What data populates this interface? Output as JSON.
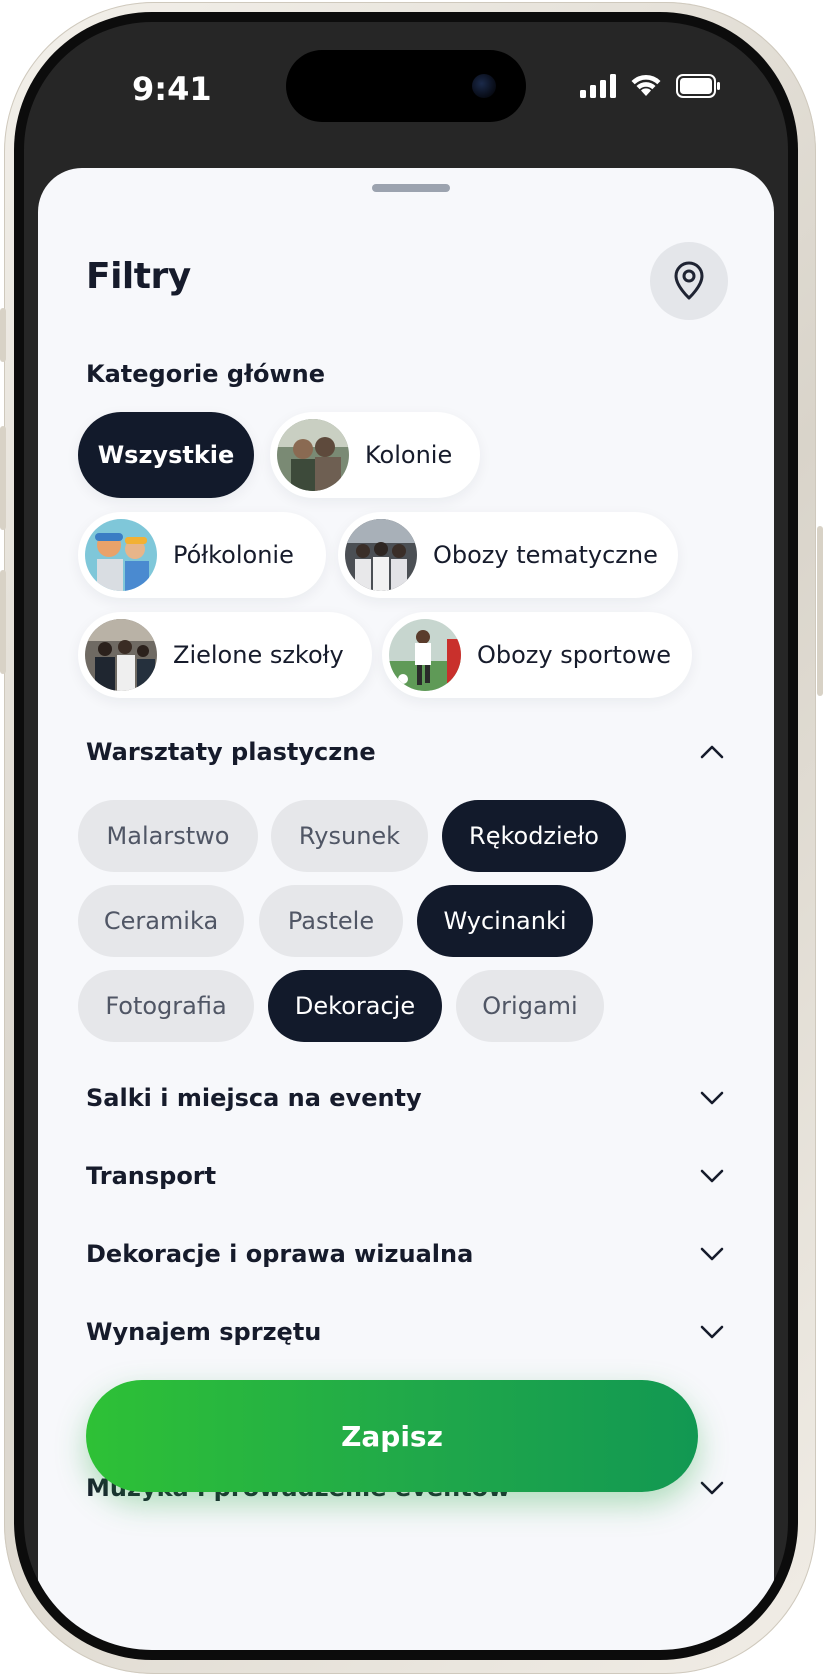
{
  "status_bar": {
    "time": "9:41"
  },
  "sheet": {
    "title": "Filtry",
    "main_categories_label": "Kategorie główne",
    "categories": [
      {
        "label": "Wszystkie",
        "selected": true
      },
      {
        "label": "Kolonie",
        "selected": false
      },
      {
        "label": "Półkolonie",
        "selected": false
      },
      {
        "label": "Obozy tematyczne",
        "selected": false
      },
      {
        "label": "Zielone szkoły",
        "selected": false
      },
      {
        "label": "Obozy sportowe",
        "selected": false
      }
    ],
    "expanded_section": {
      "label": "Warsztaty plastyczne",
      "expanded": true,
      "options": [
        {
          "label": "Malarstwo",
          "selected": false
        },
        {
          "label": "Rysunek",
          "selected": false
        },
        {
          "label": "Rękodzieło",
          "selected": true
        },
        {
          "label": "Ceramika",
          "selected": false
        },
        {
          "label": "Pastele",
          "selected": false
        },
        {
          "label": "Wycinanki",
          "selected": true
        },
        {
          "label": "Fotografia",
          "selected": false
        },
        {
          "label": "Dekoracje",
          "selected": true
        },
        {
          "label": "Origami",
          "selected": false
        }
      ]
    },
    "collapsed_sections": [
      "Salki i miejsca na eventy",
      "Transport",
      "Dekoracje i oprawa wizualna",
      "Wynajem sprzętu",
      "Muzyka i prowadzenie eventów"
    ],
    "save_label": "Zapisz"
  },
  "colors": {
    "selected_chip": "#121a2b",
    "unselected_chip": "#e6e7ea",
    "save_gradient_start": "#2ec136",
    "save_gradient_end": "#129852",
    "sheet_background": "#f7f8fb"
  }
}
